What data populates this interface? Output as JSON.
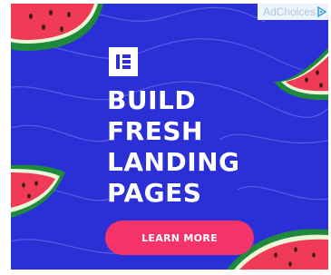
{
  "ad": {
    "brand_icon": "elementor-logo-icon",
    "headline": [
      "BUILD",
      "FRESH",
      "LANDING",
      "PAGES"
    ],
    "cta_label": "LEARN MORE",
    "adchoices_label": "AdChoices",
    "adchoices_icon": "adchoices-triangle-icon"
  },
  "colors": {
    "background": "#2a2fd6",
    "cta": "#f4336a",
    "text": "#ffffff",
    "melon_flesh": "#ef3b55",
    "melon_rind": "#1f8a3c"
  }
}
